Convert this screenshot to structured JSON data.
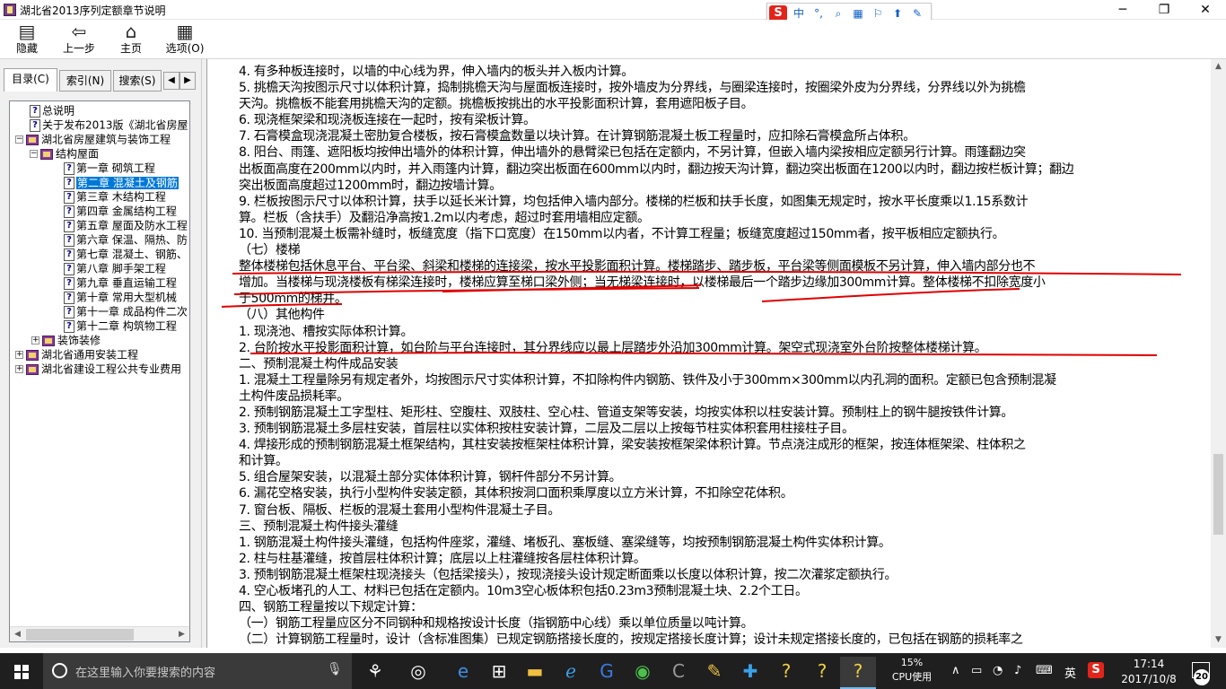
{
  "window": {
    "title": "湖北省2013序列定额章节说明",
    "min_symbol": "─",
    "max_symbol": "❐",
    "close_symbol": "✕"
  },
  "ime": {
    "logo": "S",
    "items": [
      "中",
      "°,",
      "⌕",
      "▦",
      "⚐",
      "⬆",
      "✎"
    ]
  },
  "toolbar": {
    "hide": "隐藏",
    "back": "上一步",
    "home": "主页",
    "options": "选项(O)"
  },
  "tabs": {
    "toc": "目录(C)",
    "index": "索引(N)",
    "search": "搜索(S)",
    "left_arrow": "◀",
    "right_arrow": "▶"
  },
  "tree": {
    "items": [
      {
        "label": "总说明",
        "kind": "doc"
      },
      {
        "label": "关于发布2013版《湖北省房屋",
        "kind": "doc"
      },
      {
        "label": "湖北省房屋建筑与装饰工程",
        "kind": "book",
        "exp": "−"
      },
      {
        "label": "结构屋面",
        "kind": "book",
        "exp": "−"
      },
      {
        "label": "第一章  砌筑工程",
        "kind": "doc"
      },
      {
        "label": "第二章  混凝土及钢筋",
        "kind": "doc",
        "selected": true
      },
      {
        "label": "第三章  木结构工程",
        "kind": "doc"
      },
      {
        "label": "第四章  金属结构工程",
        "kind": "doc"
      },
      {
        "label": "第五章  屋面及防水工程",
        "kind": "doc"
      },
      {
        "label": "第六章  保温、隔热、防",
        "kind": "doc"
      },
      {
        "label": "第七章  混凝土、钢筋、",
        "kind": "doc"
      },
      {
        "label": "第八章  脚手架工程",
        "kind": "doc"
      },
      {
        "label": "第九章  垂直运输工程",
        "kind": "doc"
      },
      {
        "label": "第十章  常用大型机械",
        "kind": "doc"
      },
      {
        "label": "第十一章  成品构件二次",
        "kind": "doc"
      },
      {
        "label": "第十二章  构筑物工程",
        "kind": "doc"
      },
      {
        "label": "装饰装修",
        "kind": "book",
        "exp": "+"
      },
      {
        "label": "湖北省通用安装工程",
        "kind": "book",
        "exp": "+"
      },
      {
        "label": "湖北省建设工程公共专业费用",
        "kind": "book",
        "exp": "+"
      }
    ]
  },
  "content": {
    "lines": [
      "4. 有多种板连接时，以墙的中心线为界，伸入墙内的板头并入板内计算。",
      "5. 挑檐天沟按图示尺寸以体积计算，捣制挑檐天沟与屋面板连接时，按外墙皮为分界线，与圈梁连接时，按圈梁外皮为分界线，分界线以外为挑檐",
      "天沟。挑檐板不能套用挑檐天沟的定额。挑檐板按挑出的水平投影面积计算，套用遮阳板子目。",
      "6. 现浇框架梁和现浇板连接在一起时，按有梁板计算。",
      "7. 石膏模盒现浇混凝土密肋复合楼板，按石膏模盒数量以块计算。在计算钢筋混凝土板工程量时，应扣除石膏模盒所占体积。",
      "8. 阳台、雨篷、遮阳板均按伸出墙外的体积计算，伸出墙外的悬臂梁已包括在定额内，不另计算，但嵌入墙内梁按相应定额另行计算。雨篷翻边突",
      "出板面高度在200mm以内时，并入雨篷内计算，翻边突出板面在600mm以内时，翻边按天沟计算，翻边突出板面在1200以内时，翻边按栏板计算；翻边",
      "突出板面高度超过1200mm时，翻边按墙计算。",
      "9. 栏板按图示尺寸以体积计算，扶手以延长米计算，均包括伸入墙内部分。楼梯的栏板和扶手长度，如图集无规定时，按水平长度乘以1.15系数计",
      "算。栏板（含扶手）及翻沿净高按1.2m以内考虑，超过时套用墙相应定额。",
      "10. 当预制混凝土板需补缝时，板缝宽度（指下口宽度）在150mm以内者，不计算工程量；板缝宽度超过150mm者，按平板相应定额执行。",
      "（七）楼梯",
      "整体楼梯包括休息平台、平台梁、斜梁和楼梯的连接梁，按水平投影面积计算。楼梯踏步、踏步板，平台梁等侧面模板不另计算，伸入墙内部分也不",
      "增加。当楼梯与现浇楼板有梯梁连接时，楼梯应算至梯口梁外侧；当无梯梁连接时，以楼梯最后一个踏步边缘加300mm计算。整体楼梯不扣除宽度小",
      "于500mm的梯井。",
      "（八）其他构件",
      "1. 现浇池、槽按实际体积计算。",
      "2. 台阶按水平投影面积计算，如台阶与平台连接时，其分界线应以最上层踏步外沿加300mm计算。架空式现浇室外台阶按整体楼梯计算。",
      "二、预制混凝土构件成品安装",
      "1. 混凝土工程量除另有规定者外，均按图示尺寸实体积计算，不扣除构件内钢筋、铁件及小于300mm×300mm以内孔洞的面积。定额已包含预制混凝",
      "土构件废品损耗率。",
      "2. 预制钢筋混凝土工字型柱、矩形柱、空腹柱、双肢柱、空心柱、管道支架等安装，均按实体积以柱安装计算。预制柱上的钢牛腿按铁件计算。",
      "3. 预制钢筋混凝土多层柱安装，首层柱以实体积按柱安装计算，二层及二层以上按每节柱实体积套用柱接柱子目。",
      "4. 焊接形成的预制钢筋混凝土框架结构，其柱安装按框架柱体积计算，梁安装按框架梁体积计算。节点浇注成形的框架，按连体框架梁、柱体积之",
      "和计算。",
      "5. 组合屋架安装，以混凝土部分实体体积计算，钢杆件部分不另计算。",
      "6. 漏花空格安装，执行小型构件安装定额，其体积按洞口面积乘厚度以立方米计算，不扣除空花体积。",
      "7. 窗台板、隔板、栏板的混凝土套用小型构件混凝土子目。",
      "三、预制混凝土构件接头灌缝",
      "1. 钢筋混凝土构件接头灌缝，包括构件座浆，灌缝、堵板孔、塞板缝、塞梁缝等，均按预制钢筋混凝土构件实体积计算。",
      "2. 柱与柱基灌缝，按首层柱体积计算；底层以上柱灌缝按各层柱体积计算。",
      "3. 预制钢筋混凝土框架柱现浇接头（包括梁接头），按现浇接头设计规定断面乘以长度以体积计算，按二次灌浆定额执行。",
      "4. 空心板堵孔的人工、材料已包括在定额内。10m3空心板体积包括0.23m3预制混凝土块、2.2个工日。",
      "四、钢筋工程量按以下规定计算：",
      "（一）钢筋工程量应区分不同钢种和规格按设计长度（指钢筋中心线）乘以单位质量以吨计算。",
      "（二）计算钢筋工程量时，设计（含标准图集）已规定钢筋搭接长度的，按规定搭接长度计算；设计未规定搭接长度的，已包括在钢筋的损耗率之"
    ]
  },
  "taskbar": {
    "search_placeholder": "在这里输入你要搜索的内容",
    "cpu_percent": "15%",
    "cpu_label": "CPU使用",
    "ime_lang": "英",
    "time": "17:14",
    "date": "2017/10/8",
    "notifications": "20",
    "tray_symbols": [
      "∧",
      "▭",
      "◔",
      "♪",
      "⌨"
    ],
    "colors": {
      "accent": "#76b9ed",
      "annotation": "#e00000",
      "selection": "#0078d7"
    }
  }
}
